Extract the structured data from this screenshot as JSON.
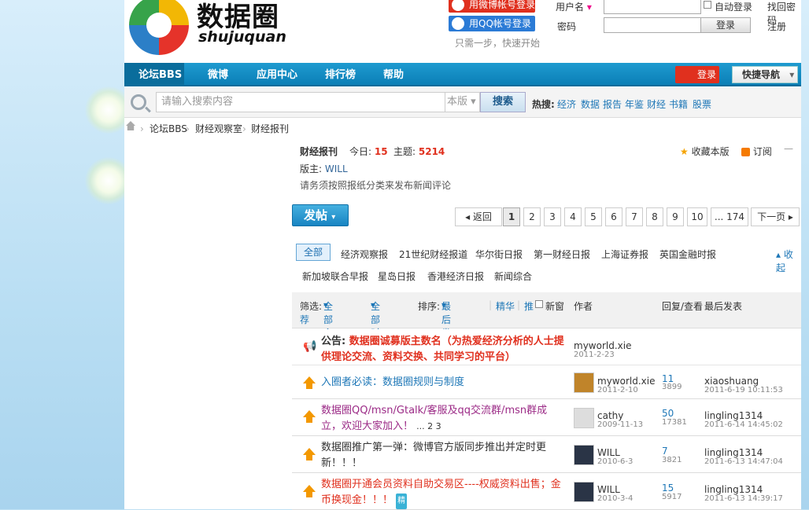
{
  "header": {
    "logo_cn": "数据圈",
    "logo_en": "shujuquan",
    "weibo_login": "用微博帐号登录",
    "qq_login": "用QQ帐号登录",
    "one_step": "只需一步，快速开始",
    "username_label": "用户名",
    "password_label": "密码",
    "auto_login": "自动登录",
    "find_password": "找回密码",
    "login_button": "登录",
    "register": "注册"
  },
  "nav": {
    "items": [
      "论坛BBS",
      "微博",
      "应用中心",
      "排行榜",
      "帮助"
    ],
    "login": "登录",
    "quick_nav": "快捷导航"
  },
  "search": {
    "placeholder": "请输入搜索内容",
    "scope": "本版",
    "button": "搜索",
    "hot_label": "热搜:",
    "hot_items": [
      "经济",
      "数据",
      "报告",
      "年鉴",
      "财经",
      "书籍",
      "股票"
    ]
  },
  "breadcrumb": [
    "论坛BBS",
    "财经观察室",
    "财经报刊"
  ],
  "forum": {
    "name": "财经报刊",
    "today_label": "今日:",
    "today": "15",
    "topics_label": "主题:",
    "topics": "5214",
    "moderator_label": "版主:",
    "moderator": "WILL",
    "description": "请务须按照报纸分类来发布新闻评论",
    "favorite": "收藏本版",
    "subscribe": "订阅"
  },
  "post_button": "发帖",
  "pagination": {
    "prev": "返回",
    "pages": [
      "1",
      "2",
      "3",
      "4",
      "5",
      "6",
      "7",
      "8",
      "9",
      "10",
      "... 174"
    ],
    "next": "下一页"
  },
  "categories": {
    "row1": [
      "全部",
      "经济观察报",
      "21世纪财经报道",
      "华尔街日报",
      "第一财经日报",
      "上海证券报",
      "英国金融时报"
    ],
    "row2": [
      "新加坡联合早报",
      "星岛日报",
      "香港经济日报",
      "新闻综合"
    ],
    "collapse": "收起"
  },
  "list_header": {
    "filter": "筛选:",
    "all_topics": "全部主题",
    "all_time": "全部时间",
    "sort": "排序:",
    "last_post_sort": "最后发表",
    "digest": "精华",
    "recommend_a": "推",
    "new_window": "新窗",
    "recommend_b": "荐",
    "author": "作者",
    "replies_views": "回复/查看",
    "last_post": "最后发表"
  },
  "threads": [
    {
      "type": "notice",
      "prefix": "公告:",
      "title": "数据圈诚募版主数名（为热爱经济分析的人士提供理论交流、资料交换、共同学习的平台）",
      "author": "myworld.xie",
      "date": "2011-2-23"
    },
    {
      "title": "入圈者必读：数据圈规则与制度",
      "author": "myworld.xie",
      "date": "2011-2-10",
      "replies": "11",
      "views": "3899",
      "last_user": "xiaoshuang",
      "last_time": "2011-6-19 10:11:53"
    },
    {
      "title": "数据圈QQ/msn/Gtalk/客服及qq交流群/msn群成立，欢迎大家加入！",
      "pages": "... 2  3",
      "author": "cathy",
      "date": "2009-11-13",
      "replies": "50",
      "views": "17381",
      "last_user": "lingling1314",
      "last_time": "2011-6-14 14:45:02"
    },
    {
      "title": "数据圈推广第一弹：微博官方版同步推出并定时更新！！！",
      "author": "WILL",
      "date": "2010-6-3",
      "replies": "7",
      "views": "3821",
      "last_user": "lingling1314",
      "last_time": "2011-6-13 14:47:04"
    },
    {
      "title": "数据圈开通会员资料自助交易区----权威资料出售；金币换现金！！！",
      "badge": "精",
      "author": "WILL",
      "date": "2010-3-4",
      "replies": "15",
      "views": "5917",
      "last_user": "lingling1314",
      "last_time": "2011-6-13 14:39:17"
    }
  ]
}
